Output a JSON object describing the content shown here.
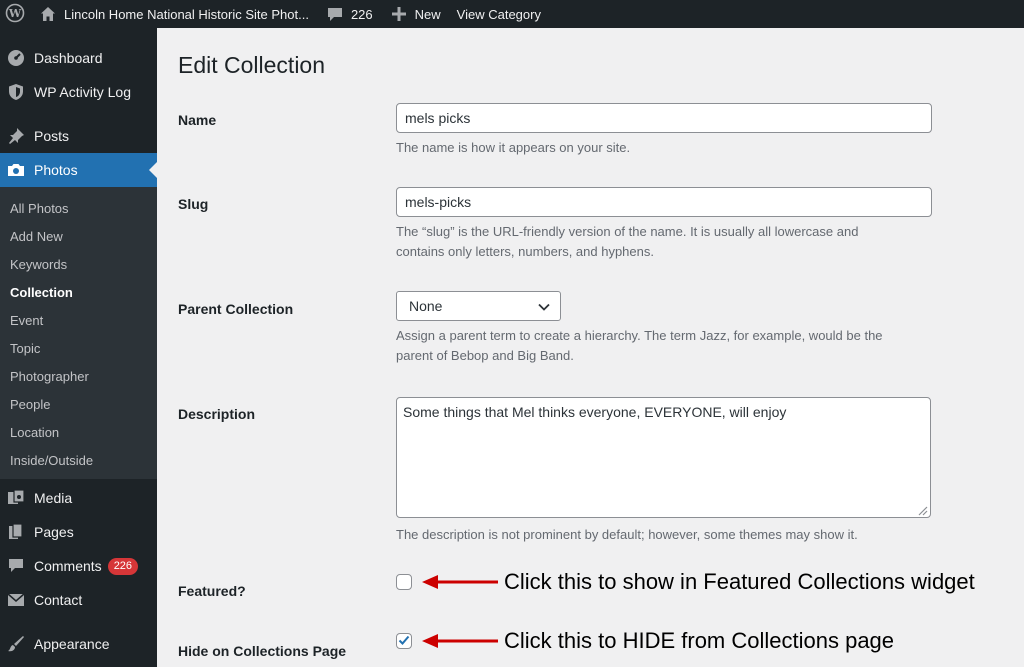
{
  "admin_bar": {
    "site_name": "Lincoln Home National Historic Site Phot...",
    "comments_count": "226",
    "new_label": "New",
    "view_label": "View Category",
    "icons": [
      "wordpress-logo-icon",
      "home-icon",
      "comment-icon",
      "plus-icon"
    ]
  },
  "sidebar": {
    "top_items": [
      {
        "label": "Dashboard",
        "icon": "dashboard-icon"
      },
      {
        "label": "WP Activity Log",
        "icon": "shield-icon"
      },
      {
        "label": "Posts",
        "icon": "pin-icon"
      },
      {
        "label": "Photos",
        "icon": "camera-icon"
      }
    ],
    "submenu": [
      "All Photos",
      "Add New",
      "Keywords",
      "Collection",
      "Event",
      "Topic",
      "Photographer",
      "People",
      "Location",
      "Inside/Outside"
    ],
    "submenu_current": "Collection",
    "bottom_items": [
      {
        "label": "Media",
        "icon": "media-icon"
      },
      {
        "label": "Pages",
        "icon": "pages-icon"
      },
      {
        "label": "Comments",
        "icon": "comments-icon",
        "badge": "226"
      },
      {
        "label": "Contact",
        "icon": "envelope-icon"
      },
      {
        "label": "Appearance",
        "icon": "brush-icon"
      }
    ]
  },
  "page": {
    "title": "Edit Collection",
    "name": {
      "label": "Name",
      "value": "mels picks",
      "help": "The name is how it appears on your site."
    },
    "slug": {
      "label": "Slug",
      "value": "mels-picks",
      "help_line1": "The “slug” is the URL-friendly version of the name. It is usually all lowercase and",
      "help_line2": "contains only letters, numbers, and hyphens."
    },
    "parent": {
      "label": "Parent Collection",
      "selected": "None",
      "help_line1": "Assign a parent term to create a hierarchy. The term Jazz, for example, would be the",
      "help_line2": "parent of Bebop and Big Band."
    },
    "description": {
      "label": "Description",
      "value": "Some things that Mel thinks everyone, EVERYONE, will enjoy",
      "help": "The description is not prominent by default; however, some themes may show it."
    },
    "featured": {
      "label": "Featured?",
      "checked": false,
      "annotation": "Click this to show in Featured Collections widget"
    },
    "hide": {
      "label": "Hide on Collections Page",
      "checked": true,
      "annotation": "Click this to HIDE from Collections page"
    }
  },
  "colors": {
    "admin_dark": "#1d2327",
    "submenu_bg": "#2c3338",
    "accent": "#2271b1",
    "badge_red": "#d63638",
    "annotation_arrow": "#cc0000"
  }
}
